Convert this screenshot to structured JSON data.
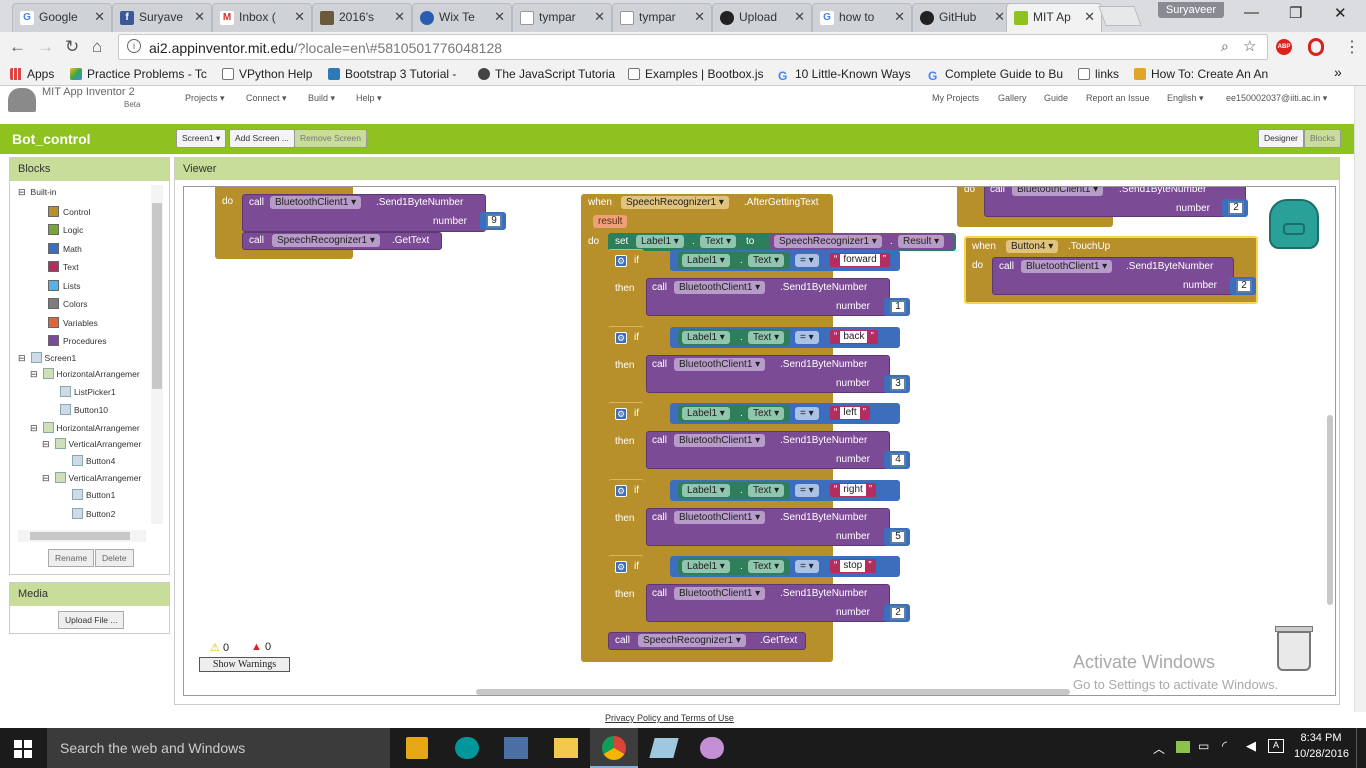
{
  "browser": {
    "tabs": [
      {
        "label": "Google",
        "icon": "google-icon",
        "color": "#4285f4"
      },
      {
        "label": "Suryave",
        "icon": "facebook-icon",
        "color": "#3b5998"
      },
      {
        "label": "Inbox (",
        "icon": "gmail-icon",
        "color": "#d93025"
      },
      {
        "label": "2016's",
        "icon": "image-icon",
        "color": "#6b5a3a"
      },
      {
        "label": "Wix Te",
        "icon": "wix-icon",
        "color": "#2a5db0"
      },
      {
        "label": "tympar",
        "icon": "page-icon",
        "color": "#888888"
      },
      {
        "label": "tympar",
        "icon": "page-icon",
        "color": "#888888"
      },
      {
        "label": "Upload",
        "icon": "github-icon",
        "color": "#222222"
      },
      {
        "label": "how to",
        "icon": "google-icon",
        "color": "#4285f4"
      },
      {
        "label": "GitHub",
        "icon": "github-icon",
        "color": "#222222"
      },
      {
        "label": "MIT Ap",
        "icon": "appinventor-icon",
        "color": "#8dc21f"
      }
    ],
    "user": "Suryaveer",
    "url_host": "ai2.appinventor.mit.edu",
    "url_rest": "/?locale=en\\#5810501776048128",
    "bookmarks": [
      {
        "label": "Apps",
        "icon": "apps-icon"
      },
      {
        "label": "Practice Problems - Tc",
        "icon": "drive-icon"
      },
      {
        "label": "VPython Help",
        "icon": "page-icon"
      },
      {
        "label": "Bootstrap 3 Tutorial -",
        "icon": "bootstrap-icon"
      },
      {
        "label": "The JavaScript Tutoria",
        "icon": "js-icon"
      },
      {
        "label": "Examples | Bootbox.js",
        "icon": "page-icon"
      },
      {
        "label": "10 Little-Known Ways",
        "icon": "google-icon"
      },
      {
        "label": "Complete Guide to Bu",
        "icon": "google-icon"
      },
      {
        "label": "links",
        "icon": "page-icon"
      },
      {
        "label": "How To: Create An An",
        "icon": "howto-icon"
      }
    ]
  },
  "app": {
    "logo_title": "MIT App Inventor 2",
    "logo_sub": "Beta",
    "menus": [
      "Projects ▾",
      "Connect ▾",
      "Build ▾",
      "Help ▾"
    ],
    "right_menus": [
      "My Projects",
      "Gallery",
      "Guide",
      "Report an Issue",
      "English ▾",
      "ee150002037@iiti.ac.in ▾"
    ],
    "project_name": "Bot_control",
    "screen_button": "Screen1 ▾",
    "add_screen": "Add Screen ...",
    "remove_screen": "Remove Screen",
    "designer": "Designer",
    "blocks": "Blocks"
  },
  "blocks_panel": {
    "title": "Blocks",
    "builtin": "Built-in",
    "items": [
      {
        "label": "Control",
        "color": "#b8902b"
      },
      {
        "label": "Logic",
        "color": "#77a53a"
      },
      {
        "label": "Math",
        "color": "#3c6ebd"
      },
      {
        "label": "Text",
        "color": "#b32d5e"
      },
      {
        "label": "Lists",
        "color": "#58b0e3"
      },
      {
        "label": "Colors",
        "color": "#7d7d7d"
      },
      {
        "label": "Variables",
        "color": "#e0663a"
      },
      {
        "label": "Procedures",
        "color": "#7c4b95"
      }
    ],
    "screen": "Screen1",
    "components": [
      "HorizontalArrangemer",
      "ListPicker1",
      "Button10",
      "HorizontalArrangemer",
      "VerticalArrangemer",
      "Button4",
      "VerticalArrangemer",
      "Button1",
      "Button2"
    ],
    "rename": "Rename",
    "delete": "Delete"
  },
  "media": {
    "title": "Media",
    "upload": "Upload File ..."
  },
  "viewer": {
    "title": "Viewer",
    "warnings_count": "0",
    "errors_count": "0",
    "show_warnings": "Show Warnings",
    "activate_title": "Activate Windows",
    "activate_sub": "Go to Settings to activate Windows."
  },
  "blocks": {
    "do": "do",
    "call": "call",
    "when": "when",
    "set": "set",
    "to": "to",
    "if": "if",
    "then": "then",
    "result": "result",
    "number": "number",
    "dot": ".",
    "bt_client": "BluetoothClient1 ▾",
    "send": ".Send1ByteNumber",
    "speech": "SpeechRecognizer1 ▾",
    "gettext": ".GetText",
    "after": ".AfterGettingText",
    "label1": "Label1 ▾",
    "text_prop": "Text ▾",
    "result_prop": "Result ▾",
    "eq": "= ▾",
    "button4": "Button4 ▾",
    "touchup": ".TouchUp",
    "num9": "9",
    "num2": "2",
    "conditions": [
      {
        "word": "forward",
        "num": "1"
      },
      {
        "word": "back",
        "num": "3"
      },
      {
        "word": "left",
        "num": "4"
      },
      {
        "word": "right",
        "num": "5"
      },
      {
        "word": "stop",
        "num": "2"
      }
    ]
  },
  "footer": {
    "privacy": "Privacy Policy and Terms of Use"
  },
  "taskbar": {
    "search": "Search the web and Windows",
    "time": "8:34 PM",
    "date": "10/28/2016"
  }
}
